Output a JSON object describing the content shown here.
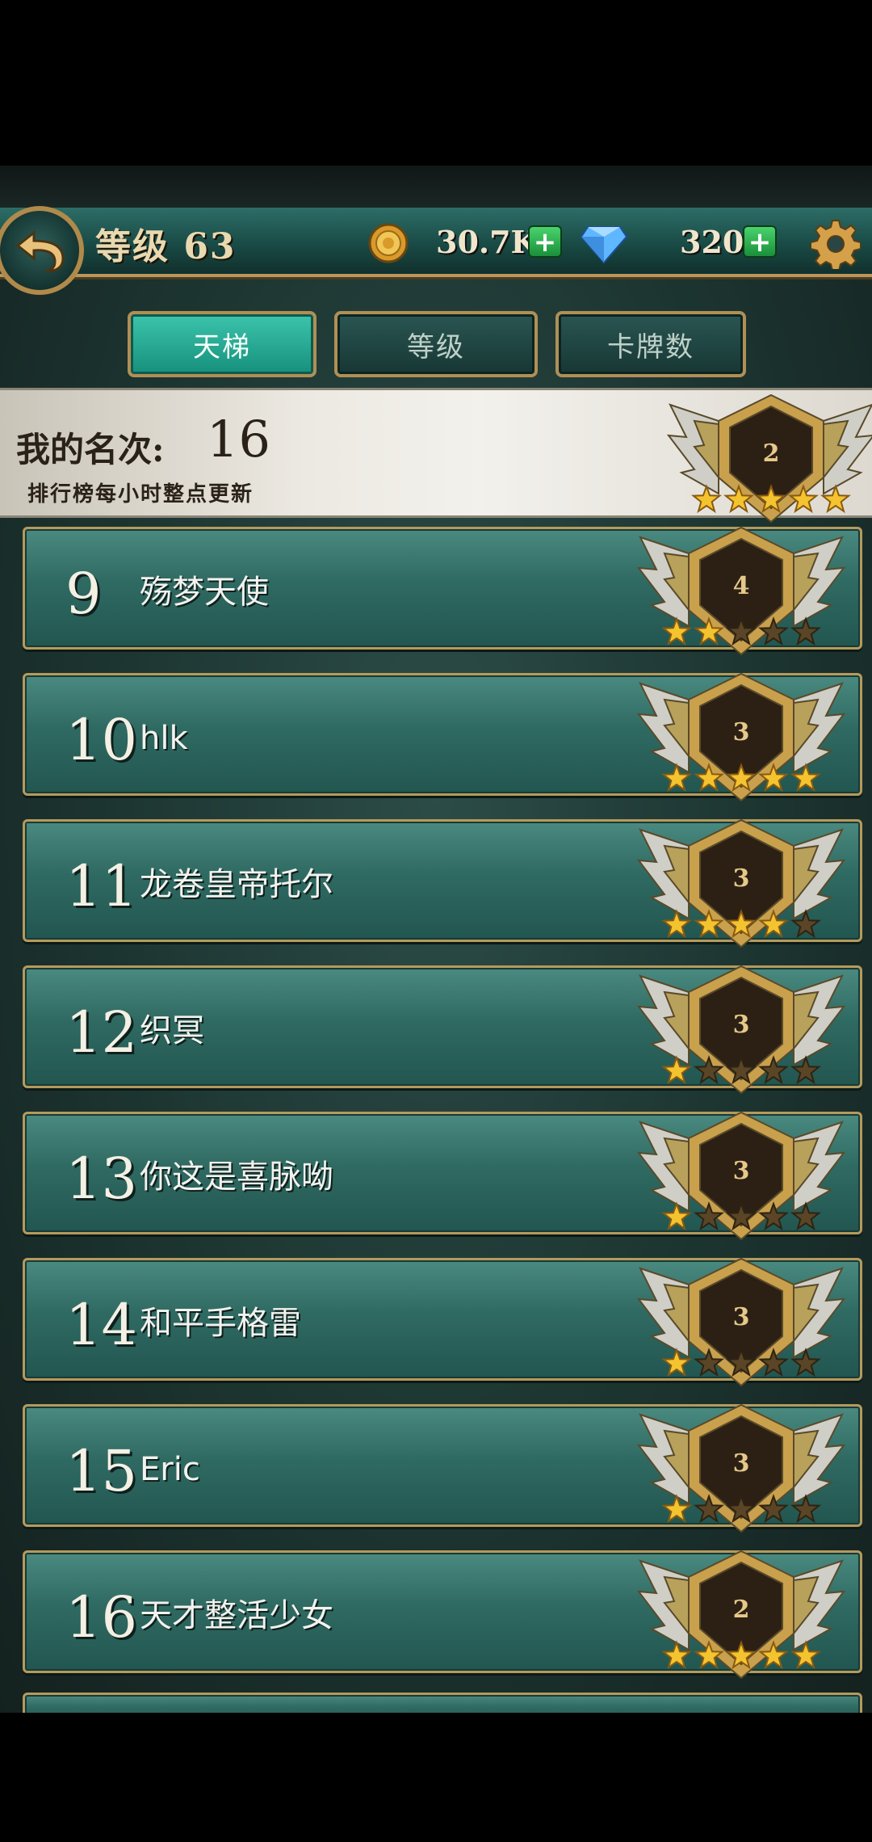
{
  "header": {
    "level_label": "等级 63",
    "gold": "30.7K",
    "gems": "320",
    "icons": {
      "back": "back-arrow-icon",
      "coin": "gold-coin-icon",
      "gem": "diamond-icon",
      "settings": "gear-icon"
    }
  },
  "tabs": [
    {
      "label": "天梯",
      "active": true
    },
    {
      "label": "等级",
      "active": false
    },
    {
      "label": "卡牌数",
      "active": false
    }
  ],
  "my_rank": {
    "label": "我的名次:",
    "value": "16",
    "note": "排行榜每小时整点更新",
    "badge_tier": "2",
    "stars": 5
  },
  "leaderboard": [
    {
      "rank": "9",
      "name": "殇梦天使",
      "tier": "4",
      "stars": 2
    },
    {
      "rank": "10",
      "name": "hlk",
      "tier": "3",
      "stars": 5
    },
    {
      "rank": "11",
      "name": "龙卷皇帝托尔",
      "tier": "3",
      "stars": 4
    },
    {
      "rank": "12",
      "name": "织冥",
      "tier": "3",
      "stars": 1
    },
    {
      "rank": "13",
      "name": "你这是喜脉呦",
      "tier": "3",
      "stars": 1
    },
    {
      "rank": "14",
      "name": "和平手格雷",
      "tier": "3",
      "stars": 1
    },
    {
      "rank": "15",
      "name": "Eric",
      "tier": "3",
      "stars": 1
    },
    {
      "rank": "16",
      "name": "天才整活少女",
      "tier": "2",
      "stars": 5
    }
  ],
  "colors": {
    "gold": "#b59a5c",
    "row": "#2f6a62",
    "active_tab": "#2aa892"
  }
}
